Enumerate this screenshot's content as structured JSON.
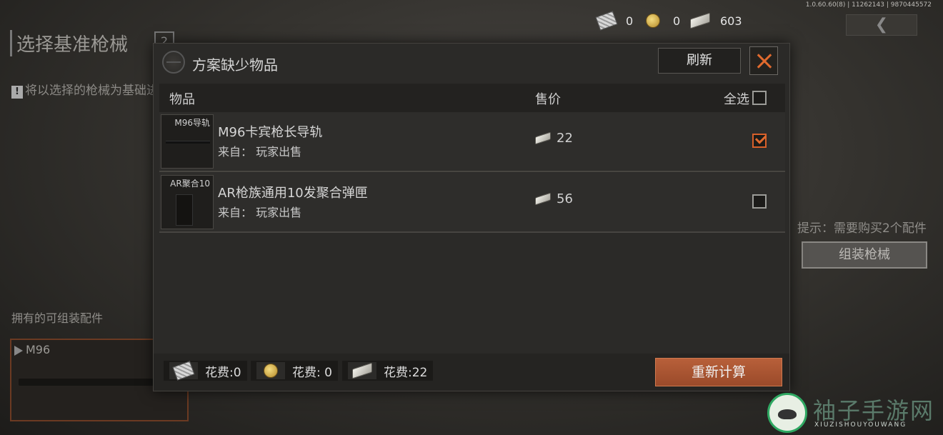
{
  "background": {
    "title": "选择基准枪械",
    "badge": "2",
    "notice": "将以选择的枪械为基础进",
    "notice_icon": "!",
    "owned_label": "拥有的可组装配件",
    "card_label": "M96",
    "hint": "提示：需要购买2个配件",
    "assemble_button": "组装枪械",
    "version": "1.0.60.60(8) | 11262143 | 9870445572"
  },
  "currency": {
    "ticket": "0",
    "coin": "0",
    "cash": "603"
  },
  "modal": {
    "title": "方案缺少物品",
    "refresh_label": "刷新",
    "columns": {
      "item": "物品",
      "price": "售价",
      "select_all": "全选"
    },
    "items": [
      {
        "thumb_label": "M96导轨",
        "name": "M96卡宾枪长导轨",
        "source": "来自：  玩家出售",
        "price": "22",
        "checked": true
      },
      {
        "thumb_label": "AR聚合10",
        "name": "AR枪族通用10发聚合弹匣",
        "source": "来自：  玩家出售",
        "price": "56",
        "checked": false
      }
    ],
    "costs": {
      "ticket": "花费:0",
      "coin": "花费: 0",
      "cash": "花费:22"
    },
    "recalc_label": "重新计算"
  },
  "watermark": {
    "text": "袖子手游网",
    "sub": "XIUZISHOUYOUWANG"
  },
  "colors": {
    "accent": "#e06a2e",
    "recalc": "#a9553a"
  }
}
